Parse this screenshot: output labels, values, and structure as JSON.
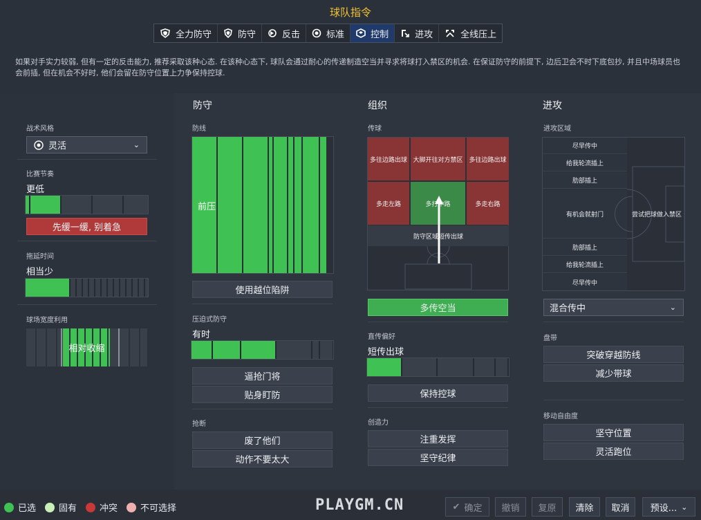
{
  "header": {
    "title": "球队指令",
    "tabs": [
      {
        "label": "全力防守",
        "icon": "shield-heavy-icon"
      },
      {
        "label": "防守",
        "icon": "shield-icon"
      },
      {
        "label": "反击",
        "icon": "counter-icon"
      },
      {
        "label": "标准",
        "icon": "balance-icon"
      },
      {
        "label": "控制",
        "icon": "control-icon",
        "active": true
      },
      {
        "label": "进攻",
        "icon": "attack-icon"
      },
      {
        "label": "全线压上",
        "icon": "all-out-attack-icon"
      }
    ],
    "description": "如果对手实力较弱, 但有一定的反击能力, 推荐采取该种心态. 在该种心态下, 球队会通过耐心的传递制造空当并寻求将球打入禁区的机会. 在保证防守的前提下, 边后卫会不时下底包抄, 并且中场球员也会前插, 但在机会不好时, 他们会留在防守位置上力争保持控球."
  },
  "general": {
    "style_label": "战术风格",
    "style_value": "灵活",
    "tempo_label": "比赛节奏",
    "tempo_value": "更低",
    "tempo_level": 0.25,
    "tempo_button": "先缓一缓, 别着急",
    "time_label": "拖延时间",
    "time_value": "相当少",
    "time_level": 0.3,
    "width_label": "球场宽度利用",
    "width_value": "相对收缩"
  },
  "defence": {
    "heading": "防守",
    "line_label": "防线",
    "line_value": "前压",
    "line_button": "使用越位陷阱",
    "press_label": "压迫式防守",
    "press_value": "有时",
    "press_level": 0.6,
    "press_btn1": "逼抢门将",
    "press_btn2": "贴身盯防",
    "tackle_label": "抢断",
    "tackle_btn1": "废了他们",
    "tackle_btn2": "动作不要太大"
  },
  "organise": {
    "heading": "组织",
    "pass_label": "传球",
    "zones": [
      "多往边路出球",
      "大脚开往对方禁区",
      "多往边路出球",
      "多走左路",
      "多打中路",
      "多走右路",
      "防守区域短传出球"
    ],
    "pass_button": "多传空当",
    "pref_label": "直传偏好",
    "pref_value": "短传出球",
    "pref_level": 0.25,
    "pref_button": "保持控球",
    "creat_label": "创造力",
    "creat_btn1": "注重发挥",
    "creat_btn2": "坚守纪律"
  },
  "attack": {
    "heading": "进攻",
    "area_label": "进攻区域",
    "left_zones": [
      "尽早传中",
      "给我轮流插上",
      "肋部插上",
      "有机会就射门",
      "肋部插上",
      "给我轮流插上",
      "尽早传中"
    ],
    "box_label": "尝试把球做入禁区",
    "cross_value": "混合传中",
    "drib_label": "盘带",
    "drib_btn1": "突破穿越防线",
    "drib_btn2": "减少带球",
    "free_label": "移动自由度",
    "free_btn1": "坚守位置",
    "free_btn2": "灵活跑位"
  },
  "footer": {
    "legend": [
      {
        "label": "已选",
        "color": "#3fc153"
      },
      {
        "label": "固有",
        "color": "#c8f0b8"
      },
      {
        "label": "冲突",
        "color": "#c83838"
      },
      {
        "label": "不可选择",
        "color": "#f0b0b0"
      }
    ],
    "watermark": "PLAYGM.CN",
    "confirm": "确定",
    "undo": "撤销",
    "restore": "复原",
    "clear": "清除",
    "cancel": "取消",
    "preset": "预设..."
  }
}
